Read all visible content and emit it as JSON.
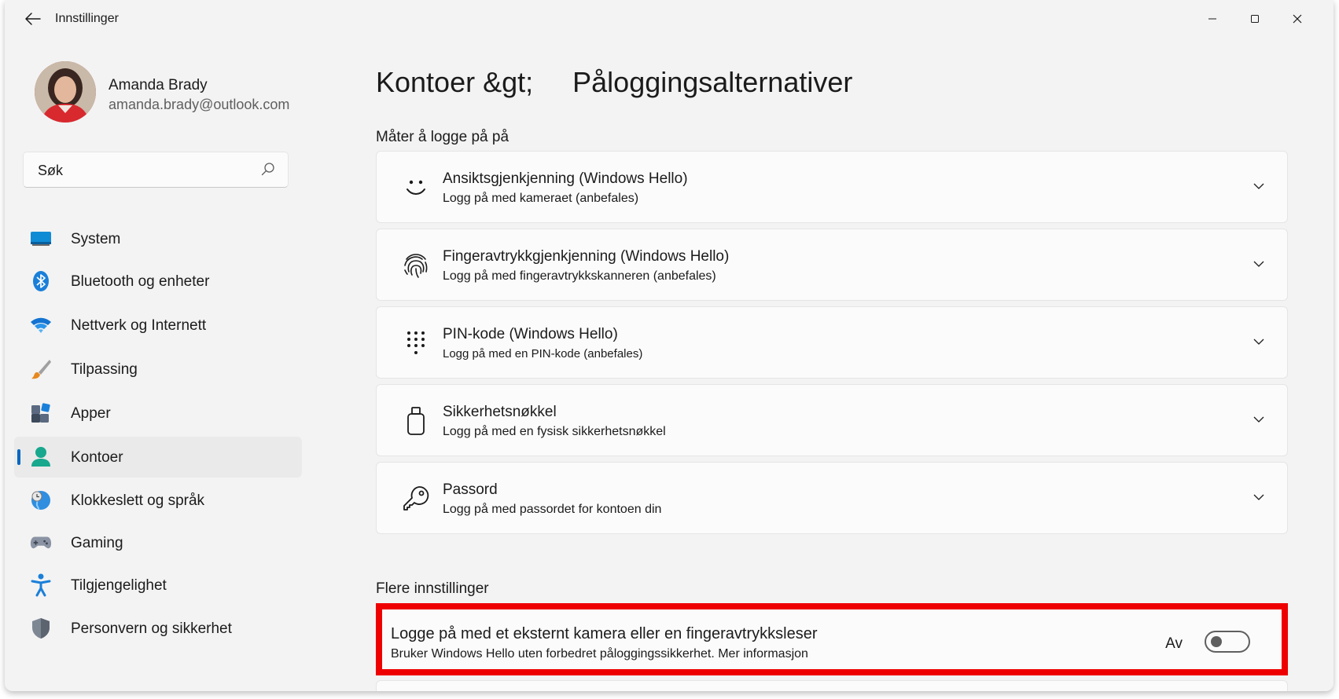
{
  "window": {
    "title": "Innstillinger"
  },
  "profile": {
    "name": "Amanda Brady",
    "email": "amanda.brady@outlook.com"
  },
  "search": {
    "placeholder": "Søk"
  },
  "sidebar": {
    "items": [
      {
        "label": "System",
        "icon": "system-icon",
        "active": false
      },
      {
        "label": "Bluetooth og enheter",
        "icon": "bluetooth-icon",
        "active": false
      },
      {
        "label": "Nettverk og Internett",
        "icon": "wifi-icon",
        "active": false
      },
      {
        "label": "Tilpassing",
        "icon": "paintbrush-icon",
        "active": false
      },
      {
        "label": "Apper",
        "icon": "apps-icon",
        "active": false
      },
      {
        "label": "Kontoer",
        "icon": "account-icon",
        "active": true
      },
      {
        "label": "Klokkeslett og språk",
        "icon": "globe-clock-icon",
        "active": false
      },
      {
        "label": "Gaming",
        "icon": "gamepad-icon",
        "active": false
      },
      {
        "label": "Tilgjengelighet",
        "icon": "accessibility-icon",
        "active": false
      },
      {
        "label": "Personvern og sikkerhet",
        "icon": "shield-icon",
        "active": false
      }
    ]
  },
  "breadcrumb": {
    "parent": "Kontoer &gt;",
    "current": "Påloggingsalternativer"
  },
  "sign_in_section": {
    "header": "Måter å logge på på",
    "options": [
      {
        "title": "Ansiktsgjenkjenning (Windows Hello)",
        "subtitle": "Logg på med kameraet (anbefales)",
        "icon": "face-icon"
      },
      {
        "title": "Fingeravtrykkgjenkjenning (Windows Hello)",
        "subtitle": "Logg på med fingeravtrykkskanneren (anbefales)",
        "icon": "fingerprint-icon"
      },
      {
        "title": "PIN-kode (Windows Hello)",
        "subtitle": "Logg på med en  PIN-kode (anbefales)",
        "icon": "pin-keypad-icon"
      },
      {
        "title": "Sikkerhetsnøkkel",
        "subtitle": "Logg på med en fysisk sikkerhetsnøkkel",
        "icon": "usb-key-icon"
      },
      {
        "title": "Passord",
        "subtitle": "Logg på med passordet for kontoen din",
        "icon": "key-icon"
      }
    ]
  },
  "more_settings": {
    "header": "Flere innstillinger",
    "external_camera": {
      "title": "Logge på med et eksternt kamera eller en fingeravtrykksleser",
      "subtitle": "Bruker Windows Hello uten forbedret påloggingssikkerhet. Mer informasjon",
      "state_label": "Av",
      "enabled": false
    }
  },
  "colors": {
    "accent": "#0067c0",
    "highlight": "#ee0000"
  }
}
